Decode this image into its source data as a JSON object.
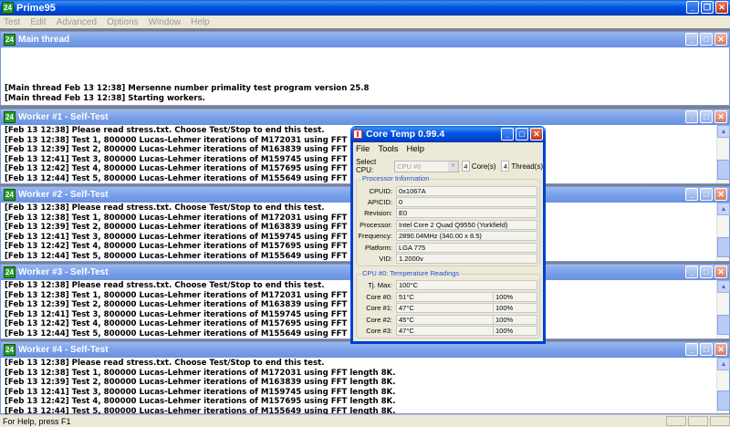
{
  "app": {
    "title": "Prime95",
    "icon_text": "24",
    "menu": [
      "Test",
      "Edit",
      "Advanced",
      "Options",
      "Window",
      "Help"
    ]
  },
  "main_thread": {
    "title": "Main thread",
    "lines": [
      "[Main thread Feb 13 12:38] Mersenne number primality test program version 25.8",
      "[Main thread Feb 13 12:38] Starting workers."
    ]
  },
  "workers": [
    {
      "title": "Worker #1 - Self-Test",
      "lines": [
        "[Feb 13 12:38] Please read stress.txt.  Choose Test/Stop to end this test.",
        "[Feb 13 12:38] Test 1, 800000 Lucas-Lehmer iterations of M172031 using FFT length 8K.",
        "[Feb 13 12:39] Test 2, 800000 Lucas-Lehmer iterations of M163839 using FFT length 8K.",
        "[Feb 13 12:41] Test 3, 800000 Lucas-Lehmer iterations of M159745 using FFT length 8K.",
        "[Feb 13 12:42] Test 4, 800000 Lucas-Lehmer iterations of M157695 using FFT length 8K.",
        "[Feb 13 12:44] Test 5, 800000 Lucas-Lehmer iterations of M155649 using FFT length 8K."
      ]
    },
    {
      "title": "Worker #2 - Self-Test",
      "lines": [
        "[Feb 13 12:38] Please read stress.txt.  Choose Test/Stop to end this test.",
        "[Feb 13 12:38] Test 1, 800000 Lucas-Lehmer iterations of M172031 using FFT length 8K.",
        "[Feb 13 12:39] Test 2, 800000 Lucas-Lehmer iterations of M163839 using FFT length 8K.",
        "[Feb 13 12:41] Test 3, 800000 Lucas-Lehmer iterations of M159745 using FFT length 8K.",
        "[Feb 13 12:42] Test 4, 800000 Lucas-Lehmer iterations of M157695 using FFT length 8K.",
        "[Feb 13 12:44] Test 5, 800000 Lucas-Lehmer iterations of M155649 using FFT length 8K."
      ]
    },
    {
      "title": "Worker #3 - Self-Test",
      "lines": [
        "[Feb 13 12:38] Please read stress.txt.  Choose Test/Stop to end this test.",
        "[Feb 13 12:38] Test 1, 800000 Lucas-Lehmer iterations of M172031 using FFT length 8K.",
        "[Feb 13 12:39] Test 2, 800000 Lucas-Lehmer iterations of M163839 using FFT length 8K.",
        "[Feb 13 12:41] Test 3, 800000 Lucas-Lehmer iterations of M159745 using FFT length 8K.",
        "[Feb 13 12:42] Test 4, 800000 Lucas-Lehmer iterations of M157695 using FFT length 8K.",
        "[Feb 13 12:44] Test 5, 800000 Lucas-Lehmer iterations of M155649 using FFT length 8K."
      ]
    },
    {
      "title": "Worker #4 - Self-Test",
      "lines": [
        "[Feb 13 12:38] Please read stress.txt.  Choose Test/Stop to end this test.",
        "[Feb 13 12:38] Test 1, 800000 Lucas-Lehmer iterations of M172031 using FFT length 8K.",
        "[Feb 13 12:39] Test 2, 800000 Lucas-Lehmer iterations of M163839 using FFT length 8K.",
        "[Feb 13 12:41] Test 3, 800000 Lucas-Lehmer iterations of M159745 using FFT length 8K.",
        "[Feb 13 12:42] Test 4, 800000 Lucas-Lehmer iterations of M157695 using FFT length 8K.",
        "[Feb 13 12:44] Test 5, 800000 Lucas-Lehmer iterations of M155649 using FFT length 8K."
      ]
    }
  ],
  "status": {
    "text": "For Help, press F1"
  },
  "coretemp": {
    "title": "Core Temp 0.99.4",
    "menu": [
      "File",
      "Tools",
      "Help"
    ],
    "select_cpu_label": "Select CPU:",
    "cpu_selected": "CPU #0",
    "cores_count": "4",
    "cores_label": "Core(s)",
    "threads_count": "4",
    "threads_label": "Thread(s)",
    "proc_info_title": "Processor Information",
    "proc_info": [
      {
        "label": "CPUID:",
        "value": "0x1067A"
      },
      {
        "label": "APICID:",
        "value": "0"
      },
      {
        "label": "Revision:",
        "value": "E0"
      },
      {
        "label": "Processor:",
        "value": "Intel Core 2 Quad Q9550 (Yorkfield)"
      },
      {
        "label": "Frequency:",
        "value": "2890.04MHz (340.00 x 8.5)"
      },
      {
        "label": "Platform:",
        "value": "LGA 775"
      },
      {
        "label": "VID:",
        "value": "1.2000v"
      }
    ],
    "temp_title": "CPU #0: Temperature Readings",
    "tj_max_label": "Tj. Max:",
    "tj_max_value": "100°C",
    "cores": [
      {
        "label": "Core #0:",
        "temp": "51°C",
        "load": "100%"
      },
      {
        "label": "Core #1:",
        "temp": "47°C",
        "load": "100%"
      },
      {
        "label": "Core #2:",
        "temp": "45°C",
        "load": "100%"
      },
      {
        "label": "Core #3:",
        "temp": "47°C",
        "load": "100%"
      }
    ]
  }
}
